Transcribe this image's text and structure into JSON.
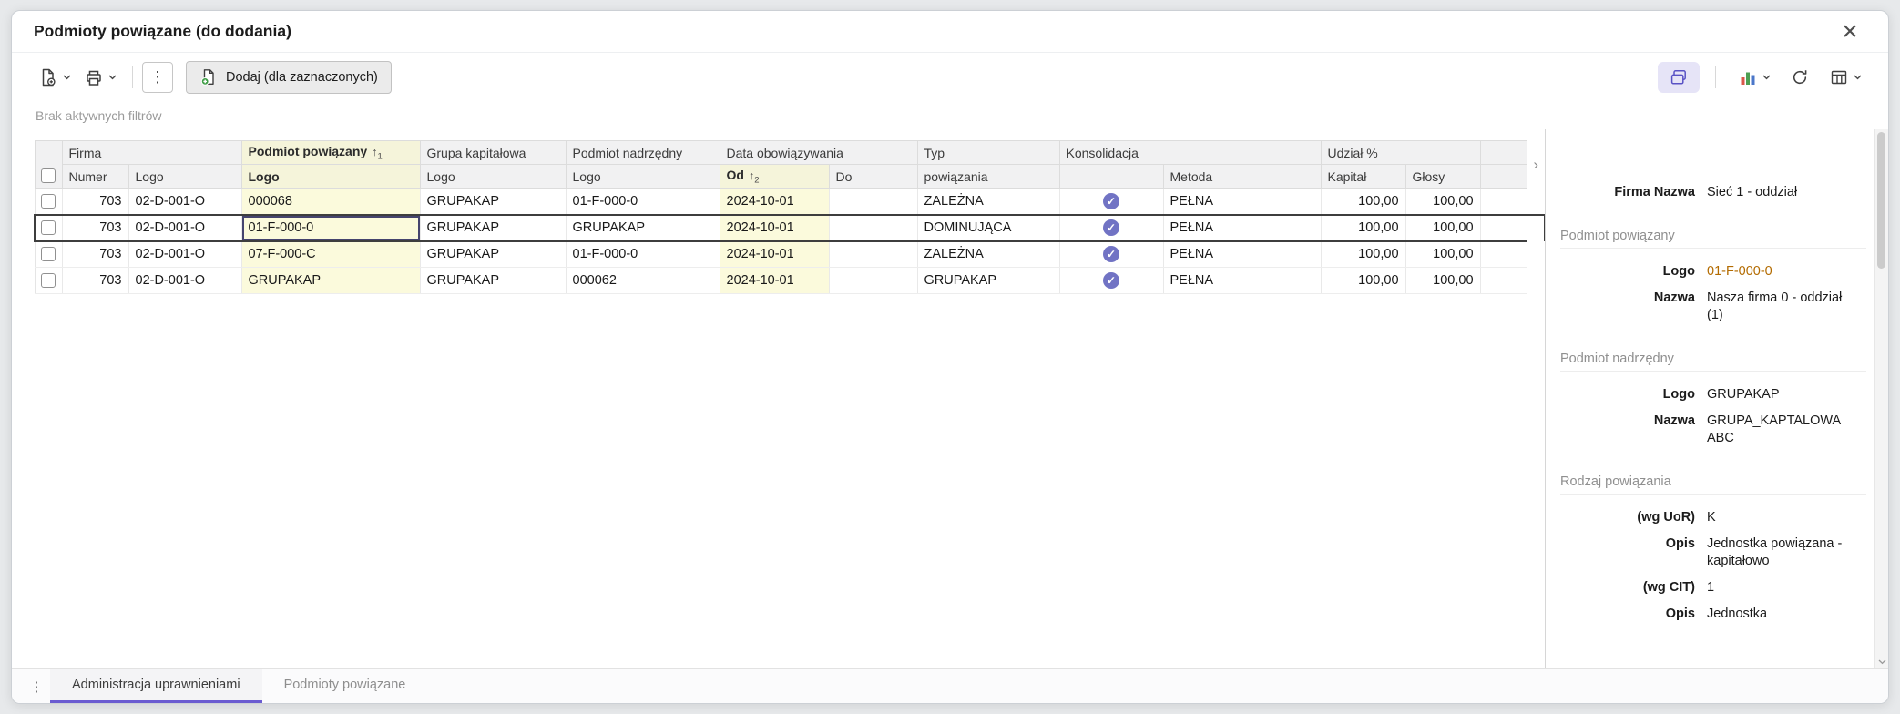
{
  "window": {
    "title": "Podmioty powiązane (do dodania)"
  },
  "toolbar": {
    "add_selected_label": "Dodaj (dla zaznaczonych)",
    "filters_status": "Brak aktywnych filtrów"
  },
  "table": {
    "group_firma": "Firma",
    "group_podmiot": "Podmiot powiązany",
    "group_grupa": "Grupa kapitałowa",
    "group_nadrzedny": "Podmiot nadrzędny",
    "group_data": "Data obowiązywania",
    "group_typ": "Typ",
    "group_konsolidacja": "Konsolidacja",
    "group_udzial": "Udział %",
    "col_numer": "Numer",
    "col_logo": "Logo",
    "col_od": "Od",
    "col_do": "Do",
    "col_powiazania": "powiązania",
    "col_metoda": "Metoda",
    "col_kapital": "Kapitał",
    "col_glosy": "Głosy",
    "sort_podmiot": "1",
    "sort_od": "2",
    "rows": [
      {
        "numer": "703",
        "firma_logo": "02-D-001-O",
        "podmiot_logo": "000068",
        "grupa_logo": "GRUPAKAP",
        "nadrzedny_logo": "01-F-000-0",
        "od": "2024-10-01",
        "do": "",
        "typ": "ZALEŻNA",
        "metoda": "PEŁNA",
        "kapital": "100,00",
        "glosy": "100,00"
      },
      {
        "numer": "703",
        "firma_logo": "02-D-001-O",
        "podmiot_logo": "01-F-000-0",
        "grupa_logo": "GRUPAKAP",
        "nadrzedny_logo": "GRUPAKAP",
        "od": "2024-10-01",
        "do": "",
        "typ": "DOMINUJĄCA",
        "metoda": "PEŁNA",
        "kapital": "100,00",
        "glosy": "100,00"
      },
      {
        "numer": "703",
        "firma_logo": "02-D-001-O",
        "podmiot_logo": "07-F-000-C",
        "grupa_logo": "GRUPAKAP",
        "nadrzedny_logo": "01-F-000-0",
        "od": "2024-10-01",
        "do": "",
        "typ": "ZALEŻNA",
        "metoda": "PEŁNA",
        "kapital": "100,00",
        "glosy": "100,00"
      },
      {
        "numer": "703",
        "firma_logo": "02-D-001-O",
        "podmiot_logo": "GRUPAKAP",
        "grupa_logo": "GRUPAKAP",
        "nadrzedny_logo": "000062",
        "od": "2024-10-01",
        "do": "",
        "typ": "GRUPAKAP",
        "metoda": "PEŁNA",
        "kapital": "100,00",
        "glosy": "100,00"
      }
    ]
  },
  "details": {
    "firma": {
      "label": "Firma Nazwa",
      "value": "Sieć 1 - oddział"
    },
    "podmiot": {
      "title": "Podmiot powiązany",
      "logo_label": "Logo",
      "logo_value": "01-F-000-0",
      "nazwa_label": "Nazwa",
      "nazwa_value": "Nasza firma 0 - oddział (1)"
    },
    "nadrzedny": {
      "title": "Podmiot nadrzędny",
      "logo_label": "Logo",
      "logo_value": "GRUPAKAP",
      "nazwa_label": "Nazwa",
      "nazwa_value": "GRUPA_KAPTALOWA ABC"
    },
    "rodzaj": {
      "title": "Rodzaj powiązania",
      "uor_label": "(wg UoR)",
      "uor_value": "K",
      "opis1_label": "Opis",
      "opis1_value": "Jednostka powiązana - kapitałowo",
      "cit_label": "(wg CIT)",
      "cit_value": "1",
      "opis2_label": "Opis",
      "opis2_value": "Jednostka"
    }
  },
  "tabbar": {
    "tabs": [
      {
        "label": "Administracja uprawnieniami",
        "active": true
      },
      {
        "label": "Podmioty powiązane",
        "active": false
      }
    ]
  },
  "colors": {
    "accent_purple": "#6b5cd1",
    "check_badge_purple": "#7173c4",
    "link_orange": "#b36b00",
    "highlight_yellow": "#fbfadc"
  }
}
